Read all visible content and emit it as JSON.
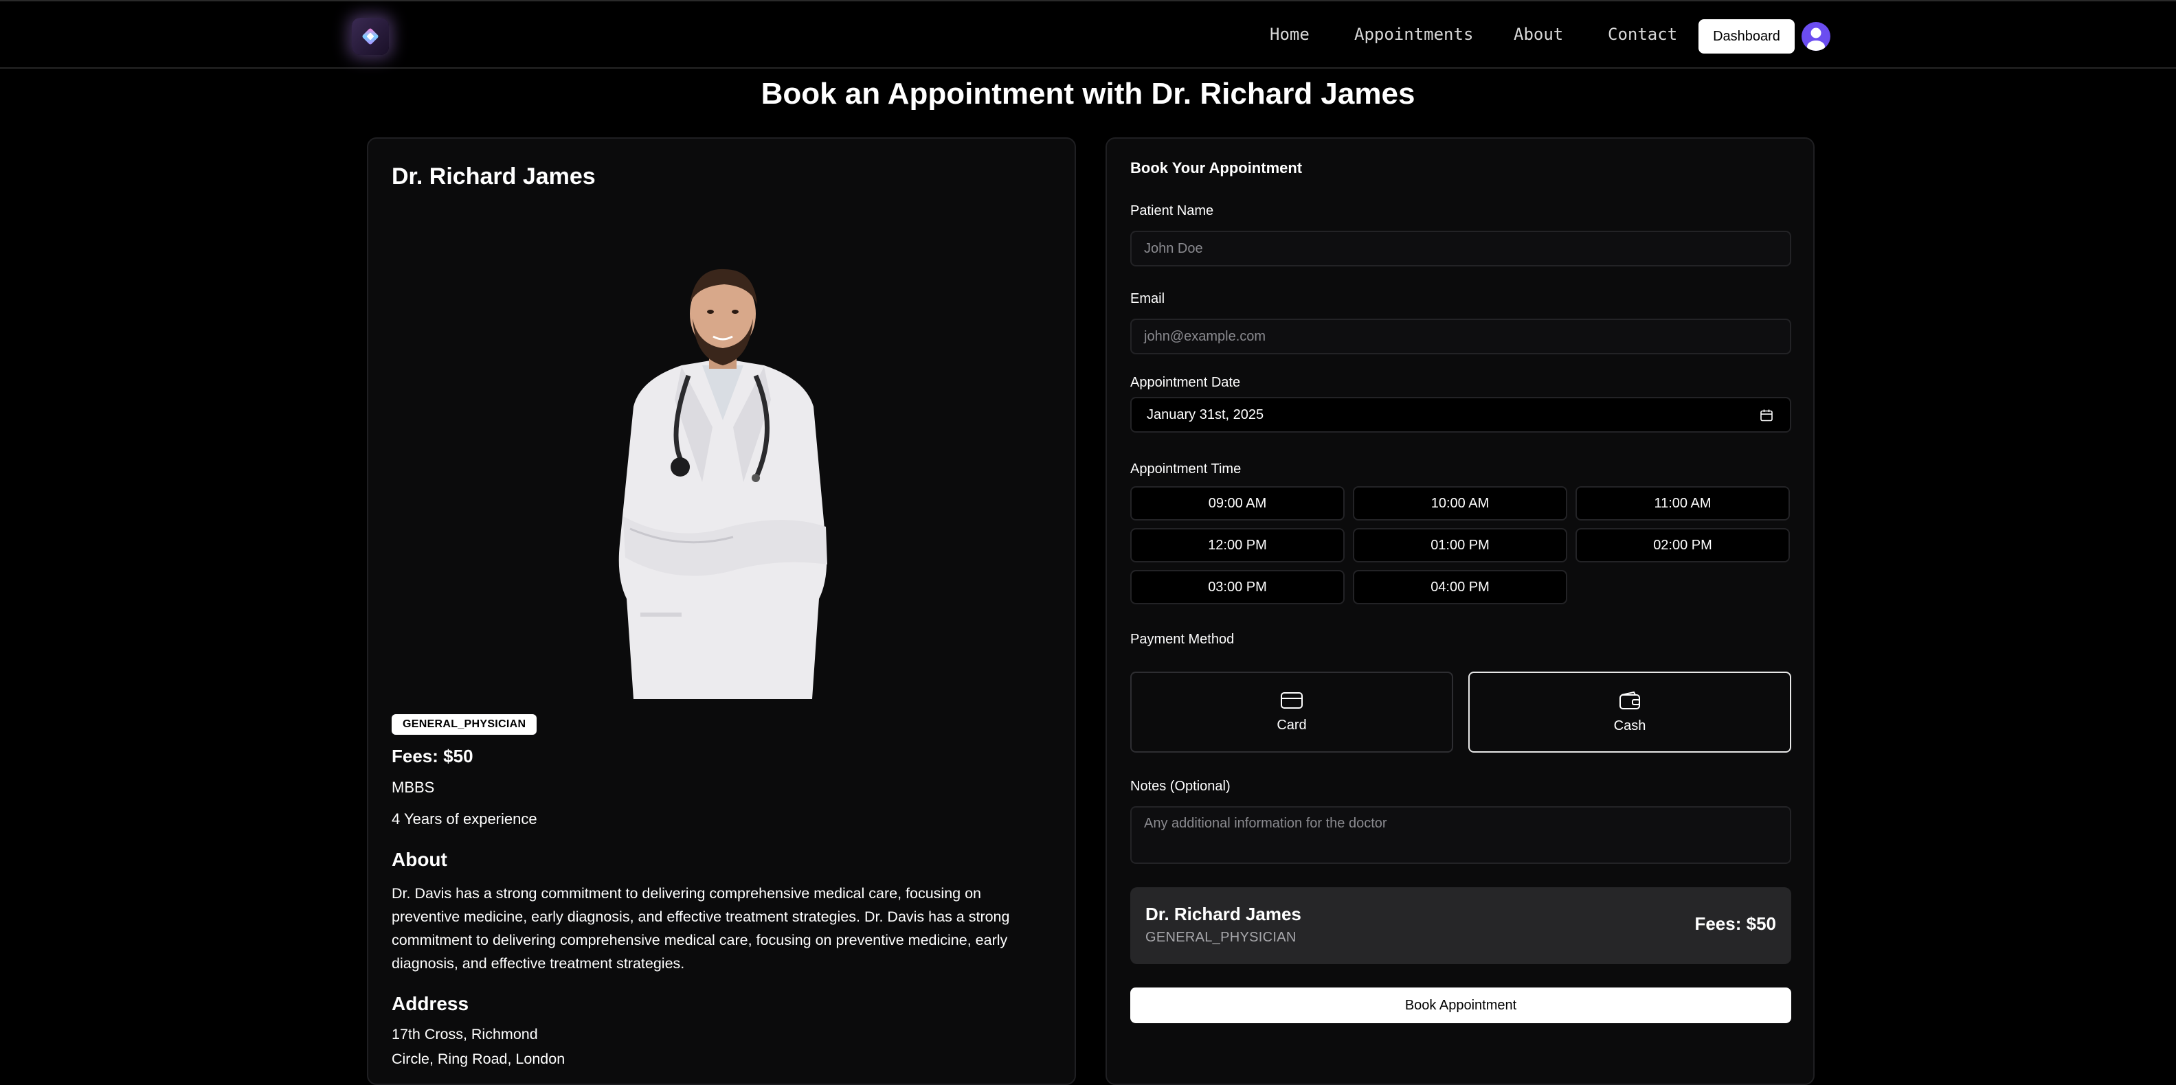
{
  "nav": {
    "links": [
      "Home",
      "Appointments",
      "About",
      "Contact"
    ],
    "dashboard_label": "Dashboard"
  },
  "page_title": "Book an Appointment with Dr. Richard James",
  "doctor": {
    "name": "Dr. Richard James",
    "specialty": "GENERAL_PHYSICIAN",
    "fees": "Fees: $50",
    "degree": "MBBS",
    "experience": "4 Years of experience",
    "about_heading": "About",
    "about_text": "Dr. Davis has a strong commitment to delivering comprehensive medical care, focusing on preventive medicine, early diagnosis, and effective treatment strategies. Dr. Davis has a strong commitment to delivering comprehensive medical care, focusing on preventive medicine, early diagnosis, and effective treatment strategies.",
    "address_heading": "Address",
    "address_line1": "17th Cross, Richmond",
    "address_line2": "Circle, Ring Road, London"
  },
  "form": {
    "title": "Book Your Appointment",
    "patient_name_label": "Patient Name",
    "patient_name_placeholder": "John Doe",
    "email_label": "Email",
    "email_placeholder": "john@example.com",
    "date_label": "Appointment Date",
    "date_value": "January 31st, 2025",
    "time_label": "Appointment Time",
    "time_slots": [
      "09:00 AM",
      "10:00 AM",
      "11:00 AM",
      "12:00 PM",
      "01:00 PM",
      "02:00 PM",
      "03:00 PM",
      "04:00 PM"
    ],
    "payment_label": "Payment Method",
    "payment_options": [
      "Card",
      "Cash"
    ],
    "payment_selected": "Cash",
    "notes_label": "Notes (Optional)",
    "notes_placeholder": "Any additional information for the doctor",
    "summary_name": "Dr. Richard James",
    "summary_specialty": "GENERAL_PHYSICIAN",
    "summary_fees": "Fees: $50",
    "submit_label": "Book Appointment"
  },
  "colors": {
    "background": "#000000",
    "card": "#0b0b0c",
    "avatar": "#6b4df0",
    "button": "#ffffff"
  }
}
